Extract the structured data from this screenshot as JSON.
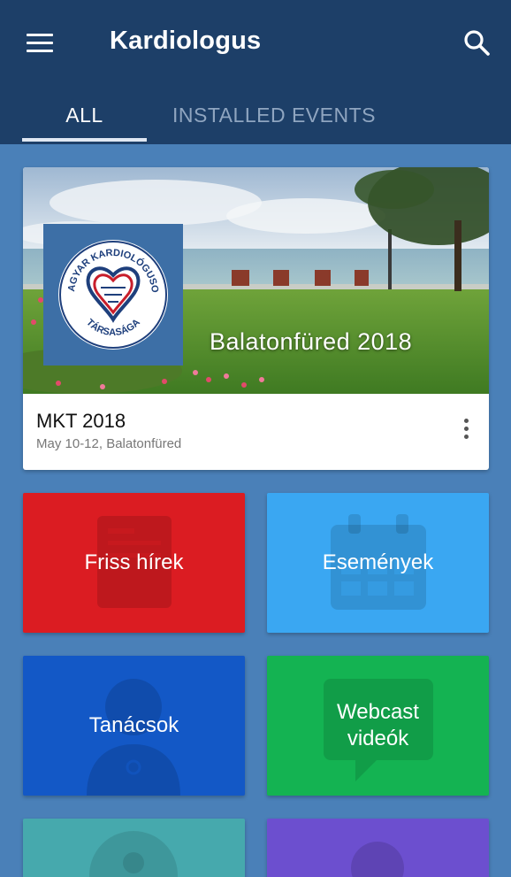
{
  "app": {
    "title": "Kardiologus",
    "menu_icon": "hamburger-menu-icon",
    "search_icon": "search-icon",
    "colors": {
      "appbar": "#1d3f68",
      "background": "#4a80b8"
    }
  },
  "tabs": [
    {
      "label": "ALL",
      "active": true
    },
    {
      "label": "INSTALLED EVENTS",
      "active": false
    }
  ],
  "event": {
    "banner_caption": "Balatonfüred 2018",
    "logo_text_top": "MAGYAR KARDIOLÓGUSOK",
    "logo_text_bottom": "TÁRSASÁGA",
    "name": "MKT 2018",
    "subtitle": "May 10-12, Balatonfüred",
    "more_icon": "more-vertical-icon"
  },
  "tiles": [
    {
      "label": "Friss hírek",
      "icon": "news-icon",
      "color": "#db1c22"
    },
    {
      "label": "Események",
      "icon": "calendar-icon",
      "color": "#3aa7f2"
    },
    {
      "label": "Tanácsok",
      "icon": "doctor-icon",
      "color": "#1358c6"
    },
    {
      "label": "Webcast\nvideók",
      "icon": "chat-bubble-icon",
      "color": "#14b352"
    },
    {
      "label": "",
      "icon": "person-icon",
      "color": "#46a9ad"
    },
    {
      "label": "",
      "icon": "person-icon",
      "color": "#6c4fcf"
    }
  ]
}
